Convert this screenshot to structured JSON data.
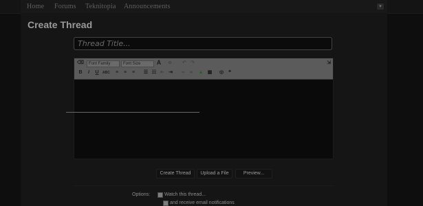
{
  "nav": {
    "items": [
      "Home",
      "Forums",
      "Teknitopia",
      "Announcements"
    ],
    "menu_icon": "chevron-down"
  },
  "page": {
    "title": "Create Thread"
  },
  "thread_title": {
    "placeholder": "Thread Title...",
    "value": ""
  },
  "editor": {
    "font_family_label": "Font Family",
    "font_size_label": "Font Size",
    "icons": [
      "eraser",
      "text-color",
      "smilies",
      "undo",
      "redo",
      "bold",
      "italic",
      "underline",
      "strikethrough",
      "align-left",
      "align-center",
      "align-right",
      "bulleted-list",
      "numbered-list",
      "outdent",
      "indent",
      "link",
      "unlink",
      "image",
      "media",
      "code",
      "quote",
      "toggle-source"
    ]
  },
  "buttons": {
    "create": "Create Thread",
    "upload": "Upload a File",
    "preview": "Preview..."
  },
  "options": {
    "label": "Options:",
    "watch": "Watch this thread...",
    "email": "and receive email notifications"
  },
  "colors": {
    "caret": "#2d7aa7",
    "background": "#0e0e0e",
    "toolbar": "#5b5b5b"
  }
}
